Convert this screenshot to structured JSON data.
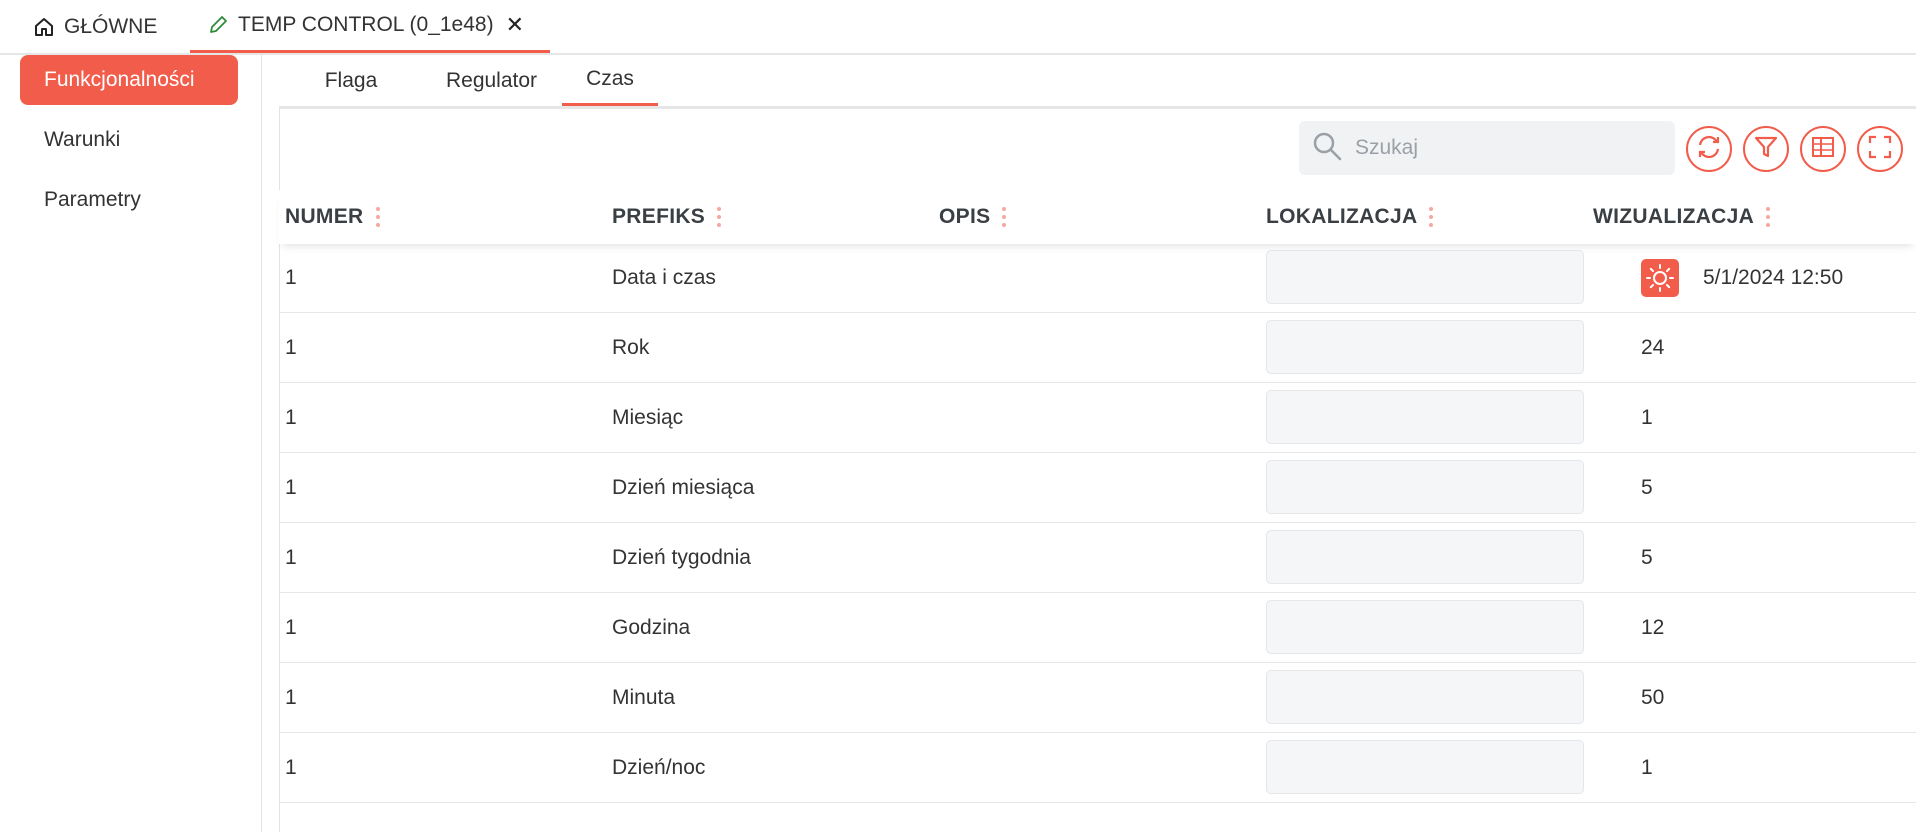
{
  "top_tabs": {
    "home_label": "GŁÓWNE",
    "temp_label": "TEMP CONTROL (0_1e48)",
    "close_glyph": "✕"
  },
  "sidebar": {
    "items": [
      {
        "label": "Funkcjonalności",
        "active": true
      },
      {
        "label": "Warunki",
        "active": false
      },
      {
        "label": "Parametry",
        "active": false
      }
    ]
  },
  "subtabs": [
    {
      "label": "Flaga",
      "active": false
    },
    {
      "label": "Regulator",
      "active": false
    },
    {
      "label": "Czas",
      "active": true
    }
  ],
  "toolbar": {
    "search_placeholder": "Szukaj",
    "buttons": [
      "refresh-icon",
      "filter-icon",
      "columns-icon",
      "fullscreen-icon"
    ]
  },
  "table": {
    "columns": [
      "NUMER",
      "PREFIKS",
      "OPIS",
      "LOKALIZACJA",
      "WIZUALIZACJA"
    ],
    "rows": [
      {
        "numer": "1",
        "prefiks": "Data i czas",
        "opis": "",
        "wizualizacja": "5/1/2024 12:50",
        "icon": "sun-icon"
      },
      {
        "numer": "1",
        "prefiks": "Rok",
        "opis": "",
        "wizualizacja": "24"
      },
      {
        "numer": "1",
        "prefiks": "Miesiąc",
        "opis": "",
        "wizualizacja": "1"
      },
      {
        "numer": "1",
        "prefiks": "Dzień miesiąca",
        "opis": "",
        "wizualizacja": "5"
      },
      {
        "numer": "1",
        "prefiks": "Dzień tygodnia",
        "opis": "",
        "wizualizacja": "5"
      },
      {
        "numer": "1",
        "prefiks": "Godzina",
        "opis": "",
        "wizualizacja": "12"
      },
      {
        "numer": "1",
        "prefiks": "Minuta",
        "opis": "",
        "wizualizacja": "50"
      },
      {
        "numer": "1",
        "prefiks": "Dzień/noc",
        "opis": "",
        "wizualizacja": "1"
      }
    ]
  },
  "colors": {
    "accent": "#f25c4b",
    "edit_icon": "#2e8b3a"
  }
}
